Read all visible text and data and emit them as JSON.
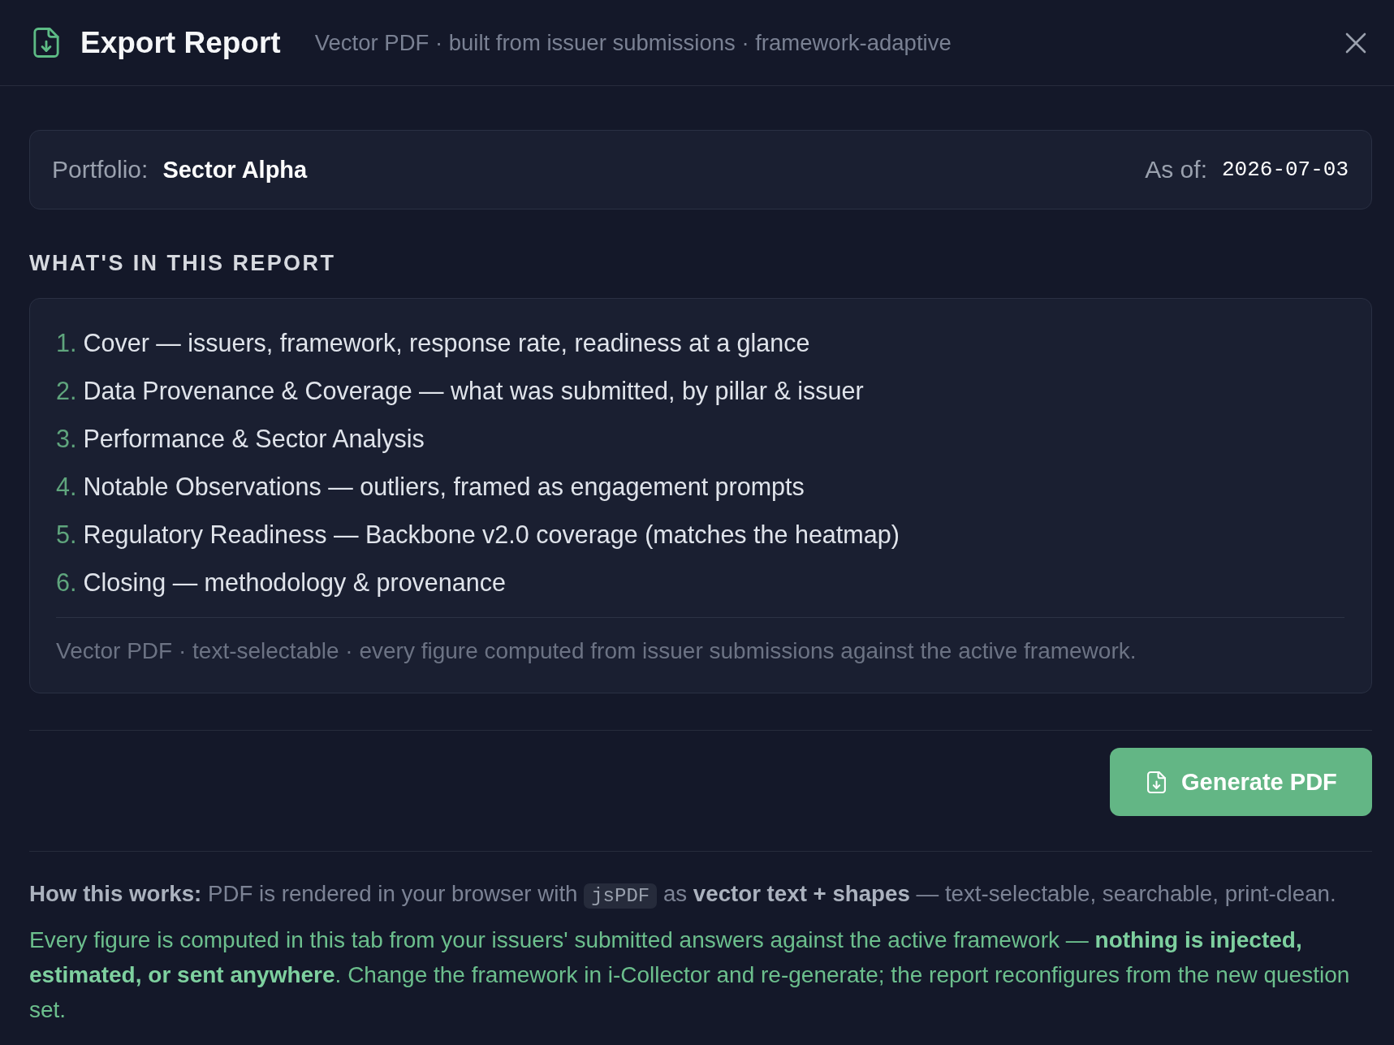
{
  "header": {
    "title": "Export Report",
    "subtitle": "Vector PDF · built from issuer submissions · framework-adaptive"
  },
  "portfolio": {
    "label": "Portfolio:",
    "value": "Sector Alpha",
    "as_of_label": "As of:",
    "as_of_value": "2026-07-03"
  },
  "contents": {
    "heading": "WHAT'S IN THIS REPORT",
    "items": [
      {
        "number": "1.",
        "text": "Cover — issuers, framework, response rate, readiness at a glance"
      },
      {
        "number": "2.",
        "text": "Data Provenance & Coverage — what was submitted, by pillar & issuer"
      },
      {
        "number": "3.",
        "text": "Performance & Sector Analysis"
      },
      {
        "number": "4.",
        "text": "Notable Observations — outliers, framed as engagement prompts"
      },
      {
        "number": "5.",
        "text": "Regulatory Readiness — Backbone v2.0 coverage (matches the heatmap)"
      },
      {
        "number": "6.",
        "text": "Closing — methodology & provenance"
      }
    ],
    "note": "Vector PDF · text-selectable · every figure computed from issuer submissions against the active framework."
  },
  "generate_button": {
    "label": "Generate PDF"
  },
  "how_it_works": {
    "parts": [
      {
        "kind": "text",
        "text": "**How this works:** PDF is rendered in your browser with "
      },
      {
        "kind": "code",
        "text": "jsPDF"
      },
      {
        "kind": "text",
        "text": " as **vector text + shapes** — text-selectable, searchable, print-clean."
      }
    ],
    "note": "Every figure is computed in this tab from your issuers' submitted answers against the active framework — **nothing is injected, estimated, or sent anywhere**. Change the framework in i-Collector and re-generate; the report reconfigures from the new question set."
  }
}
